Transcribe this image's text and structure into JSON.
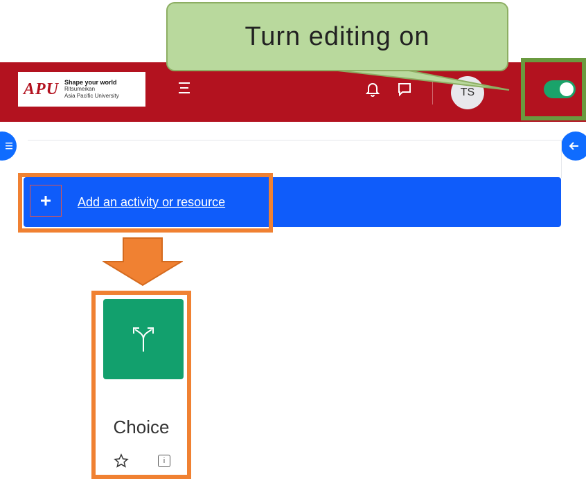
{
  "callout": {
    "text": "Turn editing on"
  },
  "navbar": {
    "brand": {
      "mark": "APU",
      "tagline": "Shape your world",
      "subline1": "Ritsumeikan",
      "subline2": "Asia Pacific University"
    },
    "avatar_initials": "TS",
    "edit_mode": true,
    "icons": {
      "menu": "hamburger-icon",
      "notifications": "bell-icon",
      "messages": "chat-icon"
    },
    "colors": {
      "bar": "#b3121f",
      "toggle_on": "#1aa36a"
    }
  },
  "main": {
    "add_activity_label": "Add an activity or resource",
    "plus_icon": "plus-icon",
    "colors": {
      "add_bar": "#0f5cfa",
      "highlight": "#f08132"
    }
  },
  "chooser": {
    "item": {
      "label": "Choice",
      "icon": "fork-icon",
      "tile_color": "#12a06d",
      "star_icon": "star-icon",
      "info_icon": "info-icon"
    }
  }
}
